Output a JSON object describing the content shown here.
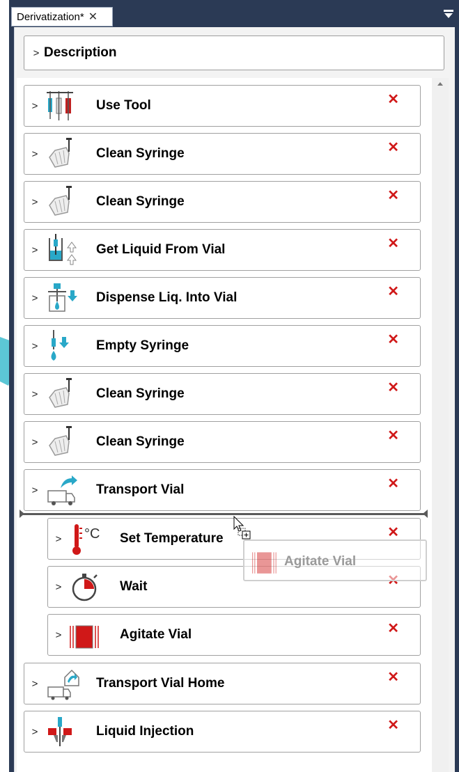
{
  "tab": {
    "title": "Derivatization*",
    "close_glyph": "✕"
  },
  "description": {
    "label": "Description",
    "chevron": ">"
  },
  "steps": [
    {
      "label": "Use Tool",
      "icon": "syringes-tool-icon",
      "chevron": ">",
      "delete_glyph": "✕"
    },
    {
      "label": "Clean Syringe",
      "icon": "clean-syringe-icon",
      "chevron": ">",
      "delete_glyph": "✕"
    },
    {
      "label": "Clean Syringe",
      "icon": "clean-syringe-icon",
      "chevron": ">",
      "delete_glyph": "✕"
    },
    {
      "label": "Get Liquid From Vial",
      "icon": "get-liquid-icon",
      "chevron": ">",
      "delete_glyph": "✕"
    },
    {
      "label": "Dispense Liq. Into Vial",
      "icon": "dispense-liquid-icon",
      "chevron": ">",
      "delete_glyph": "✕"
    },
    {
      "label": "Empty Syringe",
      "icon": "empty-syringe-icon",
      "chevron": ">",
      "delete_glyph": "✕"
    },
    {
      "label": "Clean Syringe",
      "icon": "clean-syringe-icon",
      "chevron": ">",
      "delete_glyph": "✕"
    },
    {
      "label": "Clean Syringe",
      "icon": "clean-syringe-icon",
      "chevron": ">",
      "delete_glyph": "✕"
    },
    {
      "label": "Transport Vial",
      "icon": "transport-vial-icon",
      "chevron": ">",
      "delete_glyph": "✕"
    },
    {
      "label": "Set Temperature",
      "icon": "thermometer-icon",
      "chevron": ">",
      "delete_glyph": "✕"
    },
    {
      "label": "Wait",
      "icon": "timer-icon",
      "chevron": ">",
      "delete_glyph": "✕"
    },
    {
      "label": "Agitate Vial",
      "icon": "agitate-vial-icon",
      "chevron": ">",
      "delete_glyph": "✕"
    },
    {
      "label": "Transport Vial Home",
      "icon": "transport-home-icon",
      "chevron": ">",
      "delete_glyph": "✕"
    },
    {
      "label": "Liquid Injection",
      "icon": "liquid-injection-icon",
      "chevron": ">",
      "delete_glyph": "✕"
    }
  ],
  "drag_ghost": {
    "label": "Agitate Vial",
    "icon": "agitate-vial-icon"
  },
  "colors": {
    "accent": "#d01818",
    "cyan": "#29a8c8",
    "frame": "#2b3a55",
    "arrow": "#5cc7d6"
  }
}
